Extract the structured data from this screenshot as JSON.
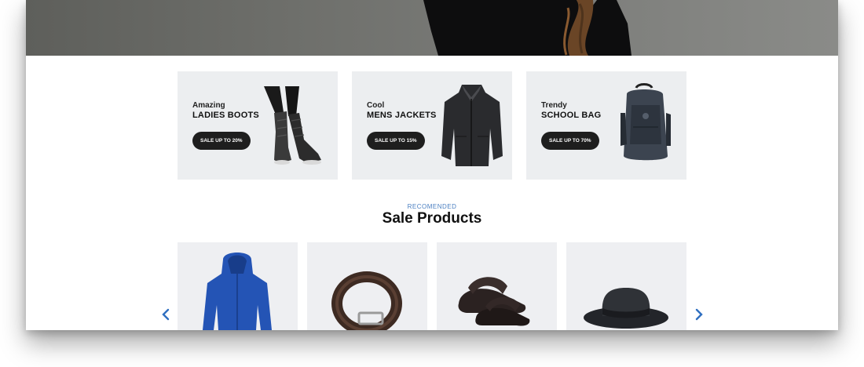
{
  "promos": [
    {
      "small": "Amazing",
      "big": "LADIES BOOTS",
      "button": "SALE UP TO 20%"
    },
    {
      "small": "Cool",
      "big": "MENS JACKETS",
      "button": "SALE UP TO 15%"
    },
    {
      "small": "Trendy",
      "big": "SCHOOL BAG",
      "button": "SALE UP TO 70%"
    }
  ],
  "section": {
    "eyebrow": "RECOMENDED",
    "title": "Sale Products"
  },
  "colors": {
    "accent": "#4a7fc1",
    "button_bg": "#1e1e1e",
    "card_bg": "#eeeff2"
  },
  "icons": {
    "prev": "chevron-left-icon",
    "next": "chevron-right-icon"
  }
}
